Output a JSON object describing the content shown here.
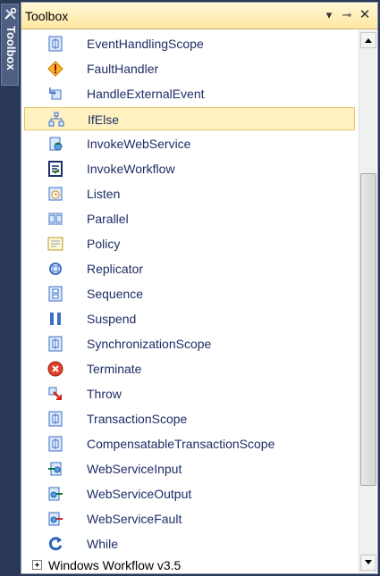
{
  "side_tab": {
    "label": "Toolbox"
  },
  "panel": {
    "title": "Toolbox",
    "buttons": {
      "dropdown": "▾",
      "pin": "⊸",
      "close": "✕"
    }
  },
  "items": [
    {
      "label": "EventHandlingScope",
      "icon": "scope-icon"
    },
    {
      "label": "FaultHandler",
      "icon": "fault-handler-icon"
    },
    {
      "label": "HandleExternalEvent",
      "icon": "handle-external-event-icon"
    },
    {
      "label": "IfElse",
      "icon": "ifelse-icon",
      "selected": true
    },
    {
      "label": "InvokeWebService",
      "icon": "invoke-web-service-icon"
    },
    {
      "label": "InvokeWorkflow",
      "icon": "invoke-workflow-icon"
    },
    {
      "label": "Listen",
      "icon": "listen-icon"
    },
    {
      "label": "Parallel",
      "icon": "parallel-icon"
    },
    {
      "label": "Policy",
      "icon": "policy-icon"
    },
    {
      "label": "Replicator",
      "icon": "replicator-icon"
    },
    {
      "label": "Sequence",
      "icon": "sequence-icon"
    },
    {
      "label": "Suspend",
      "icon": "suspend-icon"
    },
    {
      "label": "SynchronizationScope",
      "icon": "scope-icon"
    },
    {
      "label": "Terminate",
      "icon": "terminate-icon"
    },
    {
      "label": "Throw",
      "icon": "throw-icon"
    },
    {
      "label": "TransactionScope",
      "icon": "scope-icon"
    },
    {
      "label": "CompensatableTransactionScope",
      "icon": "scope-icon"
    },
    {
      "label": "WebServiceInput",
      "icon": "web-service-input-icon"
    },
    {
      "label": "WebServiceOutput",
      "icon": "web-service-output-icon"
    },
    {
      "label": "WebServiceFault",
      "icon": "web-service-fault-icon"
    },
    {
      "label": "While",
      "icon": "while-icon"
    }
  ],
  "group": {
    "label": "Windows Workflow v3.5",
    "expander": "plus-box-icon"
  },
  "colors": {
    "title_bg": "#ffe7a1",
    "selection_bg": "#fff2c0",
    "selection_border": "#e5c365",
    "item_text": "#1f2d66",
    "frame": "#293955"
  }
}
